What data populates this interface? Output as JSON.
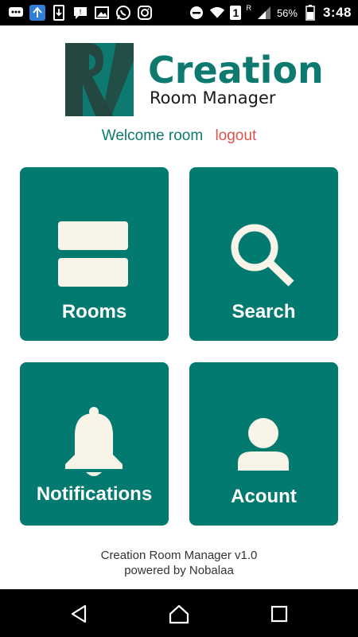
{
  "status_bar": {
    "battery_percent": "56%",
    "time": "3:48",
    "sim": "1",
    "roaming": "R",
    "icons": [
      "chat-bubble-icon",
      "sync-icon",
      "download-icon",
      "message-icon",
      "image-icon",
      "whatsapp-icon",
      "instagram-icon",
      "minus-circle-icon",
      "wifi-icon",
      "sim-icon",
      "signal-icon",
      "battery-icon"
    ]
  },
  "logo": {
    "title": "Creation",
    "subtitle": "Room Manager"
  },
  "welcome": {
    "text": "Welcome room",
    "logout": "logout"
  },
  "tiles": [
    {
      "label": "Rooms",
      "icon": "rooms-icon"
    },
    {
      "label": "Search",
      "icon": "search-icon"
    },
    {
      "label": "Notifications",
      "icon": "bell-icon"
    },
    {
      "label": "Acount",
      "icon": "account-icon"
    }
  ],
  "footer": {
    "line1": "Creation Room Manager v1.0",
    "line2": "powered by Nobalaa"
  },
  "nav": {
    "icons": [
      "back-icon",
      "home-icon",
      "recents-icon"
    ]
  },
  "colors": {
    "brand": "#037a70",
    "logout": "#d9534f",
    "icon_fill": "#f8f5e8"
  }
}
